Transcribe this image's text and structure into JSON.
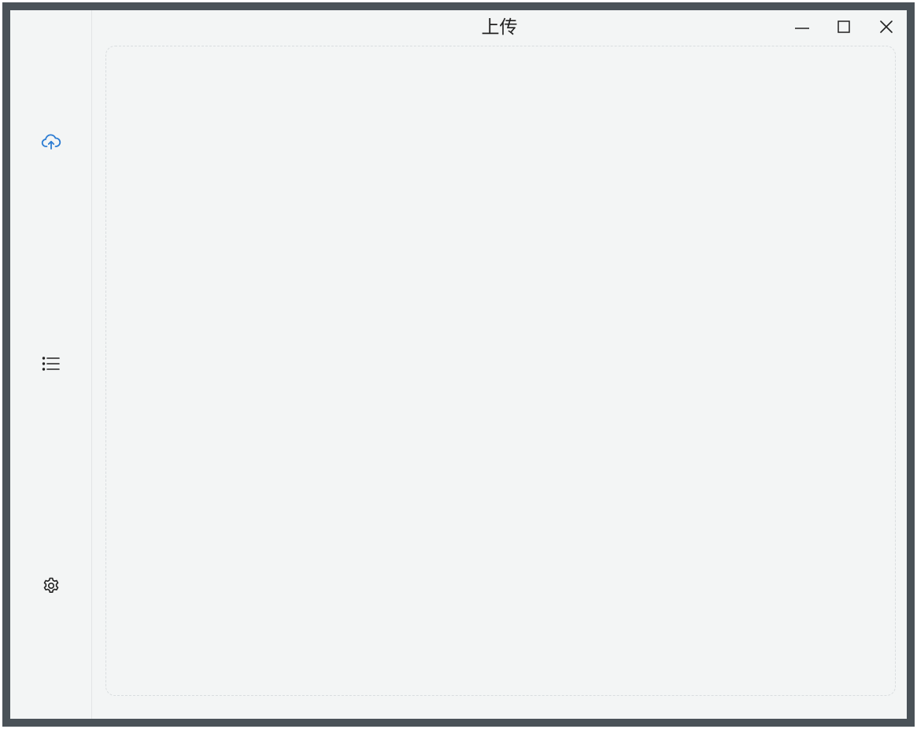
{
  "window": {
    "title": "上传"
  },
  "sidebar": {
    "items": [
      {
        "icon": "cloud-upload-icon",
        "active": true
      },
      {
        "icon": "list-icon",
        "active": false
      },
      {
        "icon": "gear-icon",
        "active": false
      }
    ]
  },
  "controls": {
    "minimize_icon": "minimize-icon",
    "maximize_icon": "maximize-icon",
    "close_icon": "close-icon"
  },
  "colors": {
    "accent": "#2b7cd3",
    "frame": "#4a5258",
    "background": "#f3f5f5",
    "icon": "#222222"
  }
}
